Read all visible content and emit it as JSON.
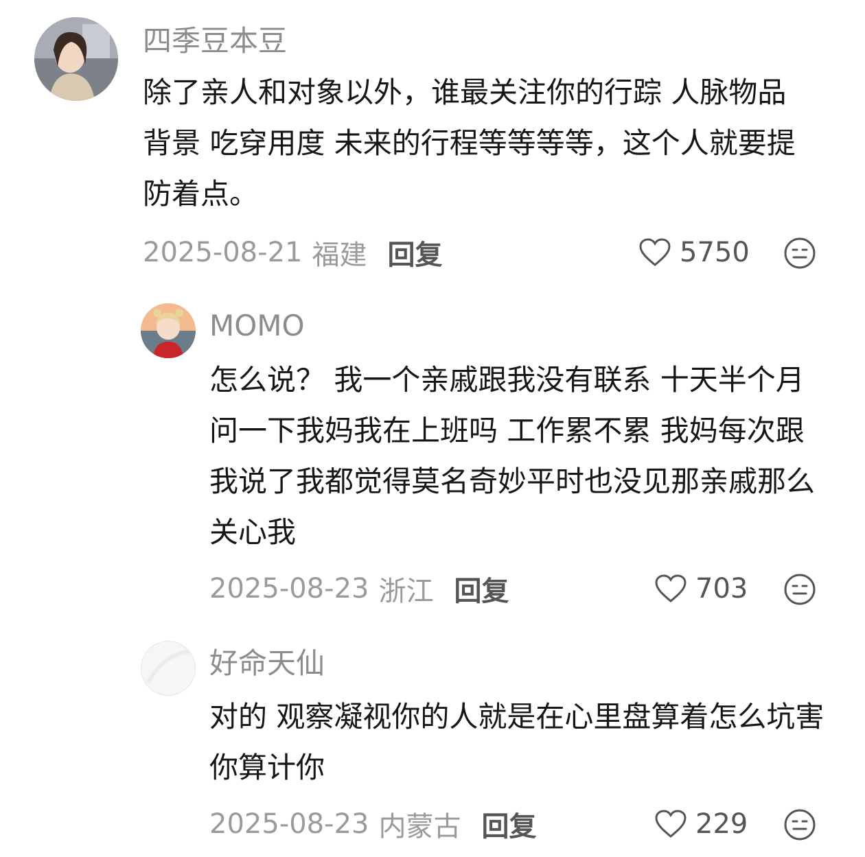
{
  "comments": [
    {
      "username": "四季豆本豆",
      "content": "除了亲人和对象以外，谁最关注你的行踪 人脉物品 背景 吃穿用度 未来的行程等等等等，这个人就要提防着点。",
      "date": "2025-08-21",
      "location": "福建",
      "reply_label": "回复",
      "likes": "5750"
    },
    {
      "username": "MOMO",
      "content": "怎么说？ 我一个亲戚跟我没有联系 十天半个月问一下我妈我在上班吗 工作累不累 我妈每次跟我说了我都觉得莫名奇妙平时也没见那亲戚那么关心我",
      "date": "2025-08-23",
      "location": "浙江",
      "reply_label": "回复",
      "likes": "703"
    },
    {
      "username": "好命天仙",
      "content": "对的 观察凝视你的人就是在心里盘算着怎么坑害你算计你",
      "date": "2025-08-23",
      "location": "内蒙古",
      "reply_label": "回复",
      "likes": "229"
    }
  ],
  "icons": {
    "like": "heart-outline-icon",
    "emoji": "meh-face-icon"
  },
  "colors": {
    "username": "#8c8c8c",
    "meta": "#9a9a9a",
    "reply": "#555555",
    "text": "#161616"
  }
}
